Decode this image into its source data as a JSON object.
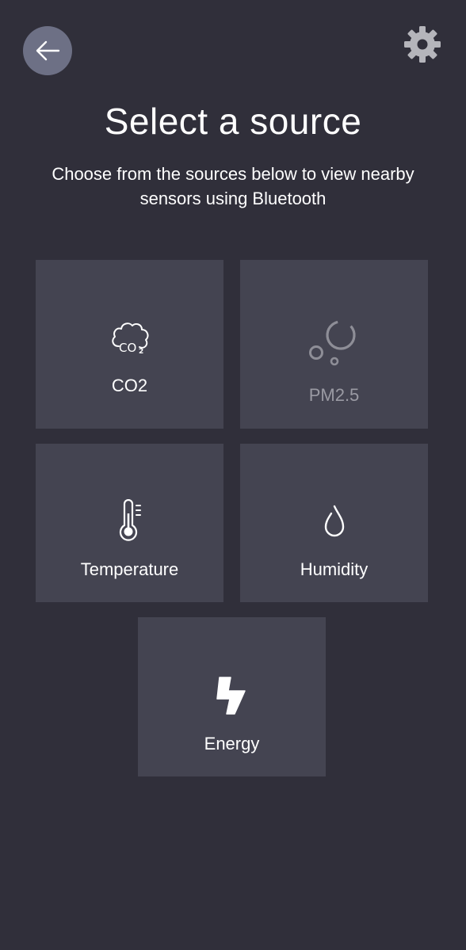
{
  "header": {
    "back_icon": "arrow-left-icon",
    "settings_icon": "gear-icon"
  },
  "main": {
    "title": "Select a source",
    "subtitle": "Choose from the sources below to view nearby sensors using Bluetooth"
  },
  "sources": [
    {
      "label": "CO2",
      "icon": "co2-cloud-icon",
      "enabled": true
    },
    {
      "label": "PM2.5",
      "icon": "particles-icon",
      "enabled": false
    },
    {
      "label": "Temperature",
      "icon": "thermometer-icon",
      "enabled": true
    },
    {
      "label": "Humidity",
      "icon": "droplet-icon",
      "enabled": true
    },
    {
      "label": "Energy",
      "icon": "lightning-icon",
      "enabled": true
    }
  ],
  "colors": {
    "background": "#302f3a",
    "tile": "#444451",
    "back_button": "#6d7085",
    "text": "#ffffff",
    "disabled_text": "#9a9aa3"
  }
}
